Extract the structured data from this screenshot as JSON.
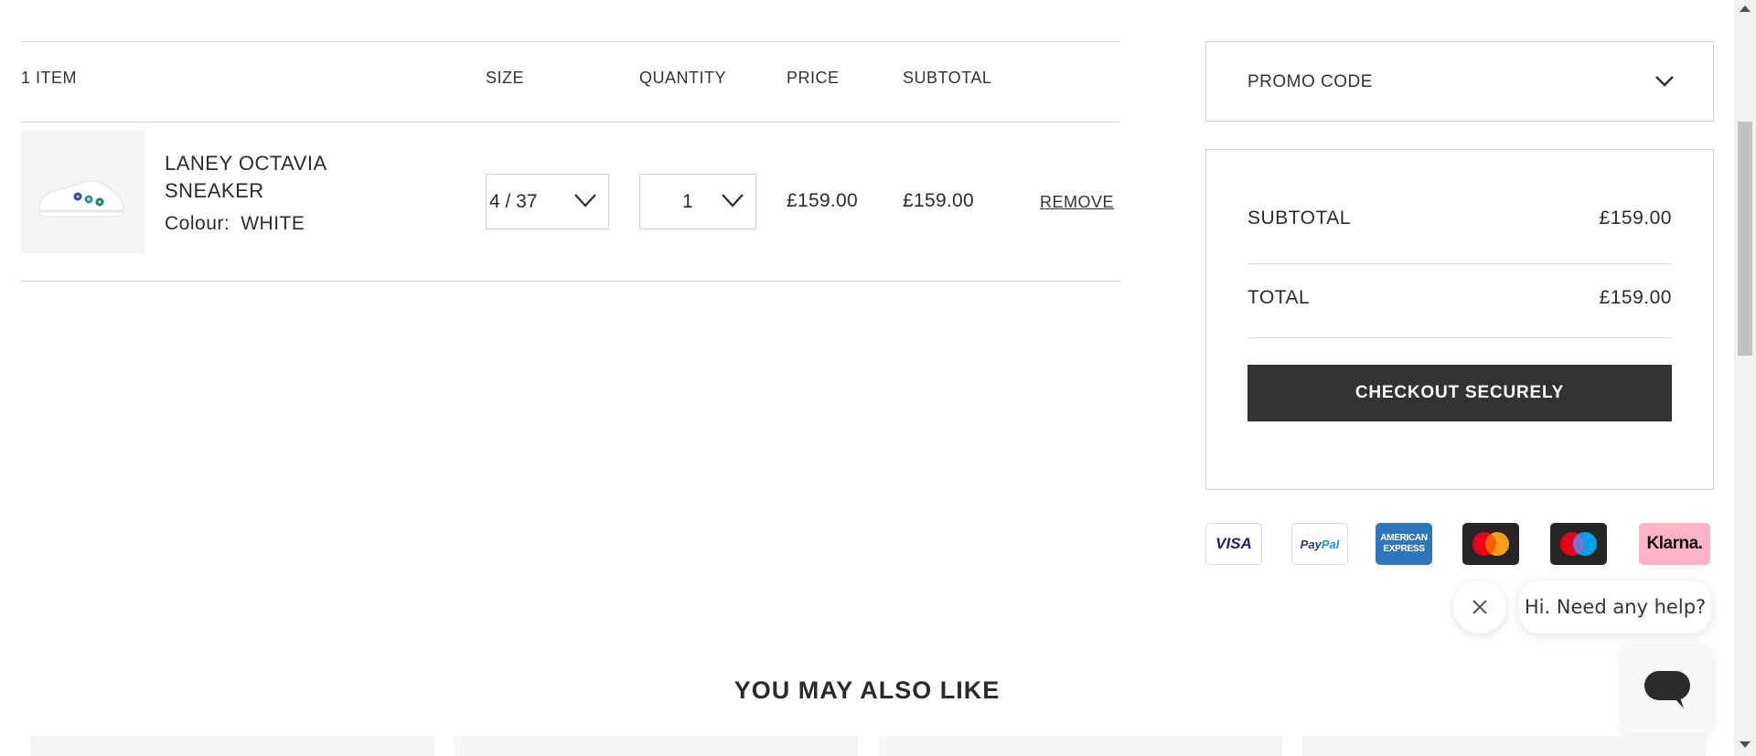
{
  "cart": {
    "headers": {
      "items": "1 ITEM",
      "size": "SIZE",
      "quantity": "QUANTITY",
      "price": "PRICE",
      "subtotal": "SUBTOTAL"
    },
    "items": [
      {
        "name": "LANEY OCTAVIA SNEAKER",
        "colour_label": "Colour:",
        "colour_value": "WHITE",
        "size": "4 / 37",
        "quantity": "1",
        "price": "£159.00",
        "subtotal": "£159.00",
        "remove_label": "REMOVE"
      }
    ]
  },
  "promo": {
    "label": "PROMO CODE"
  },
  "summary": {
    "subtotal_label": "SUBTOTAL",
    "subtotal_value": "£159.00",
    "total_label": "TOTAL",
    "total_value": "£159.00",
    "checkout_label": "CHECKOUT SECURELY",
    "checkout_color": "#333333"
  },
  "payments": {
    "visa": "VISA",
    "paypal_a": "Pay",
    "paypal_b": "Pal",
    "amex_a": "AMERICAN",
    "amex_b": "EXPRESS",
    "mastercard": "mastercard-icon",
    "maestro": "maestro-icon",
    "klarna": "Klarna."
  },
  "chat": {
    "greeting": "Hi. Need any help?",
    "close_icon": "close-icon",
    "launcher_icon": "chat-bubble-icon"
  },
  "recommendations": {
    "title": "YOU MAY ALSO LIKE"
  }
}
